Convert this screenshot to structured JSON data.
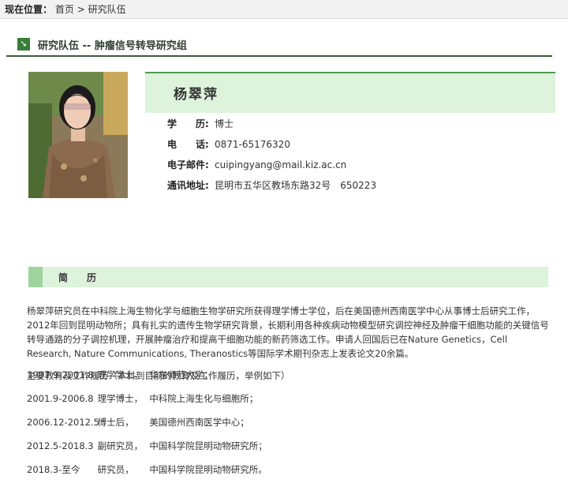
{
  "breadcrumb": {
    "label": "现在位置：",
    "home": "首页",
    "separator": ">",
    "current": "研究队伍"
  },
  "section": {
    "title": "研究队伍 -- 肿瘤信号转导研究组",
    "icon": "arrow-icon"
  },
  "profile": {
    "name": "杨翠萍",
    "fields": [
      {
        "label": "学　　历:",
        "value": "博士"
      },
      {
        "label": "电　　话:",
        "value": "0871-65176320"
      },
      {
        "label": "电子邮件:",
        "value": "cuipingyang@mail.kiz.ac.cn"
      },
      {
        "label": "通讯地址:",
        "value": "昆明市五华区教场东路32号　650223"
      }
    ]
  },
  "bio": {
    "heading": "简　历",
    "paragraph": "杨翠萍研究员在中科院上海生物化学与细胞生物学研究所获得理学博士学位，后在美国德州西南医学中心从事博士后研究工作，2012年回到昆明动物所；具有扎实的遗传生物学研究背景，长期利用各种疾病动物模型研究调控神经及肿瘤干细胞功能的关键信号转导通路的分子调控机理，开展肿瘤治疗和提高干细胞功能的新药筛选工作。申请人回国后已在Nature Genetics，Cell Research, Nature Communications, Theranostics等国际学术期刊杂志上发表论文20余篇。",
    "intro": "主要教育及工作履历（本科到目前的教育及工作履历，举例如下）",
    "history": [
      {
        "date": "1997.9-2001.8",
        "role": "理学学士，",
        "org": "华东师范大学；"
      },
      {
        "date": "2001.9-2006.8",
        "role": "理学博士，",
        "org": "中科院上海生化与细胞所；"
      },
      {
        "date": "2006.12-2012.5",
        "role": "博士后，",
        "org": "美国德州西南医学中心；"
      },
      {
        "date": "2012.5-2018.3",
        "role": "副研究员，",
        "org": "中国科学院昆明动物研究所；"
      },
      {
        "date": "2018.3-至今",
        "role": "研究员，",
        "org": "中国科学院昆明动物研究所。"
      }
    ]
  }
}
